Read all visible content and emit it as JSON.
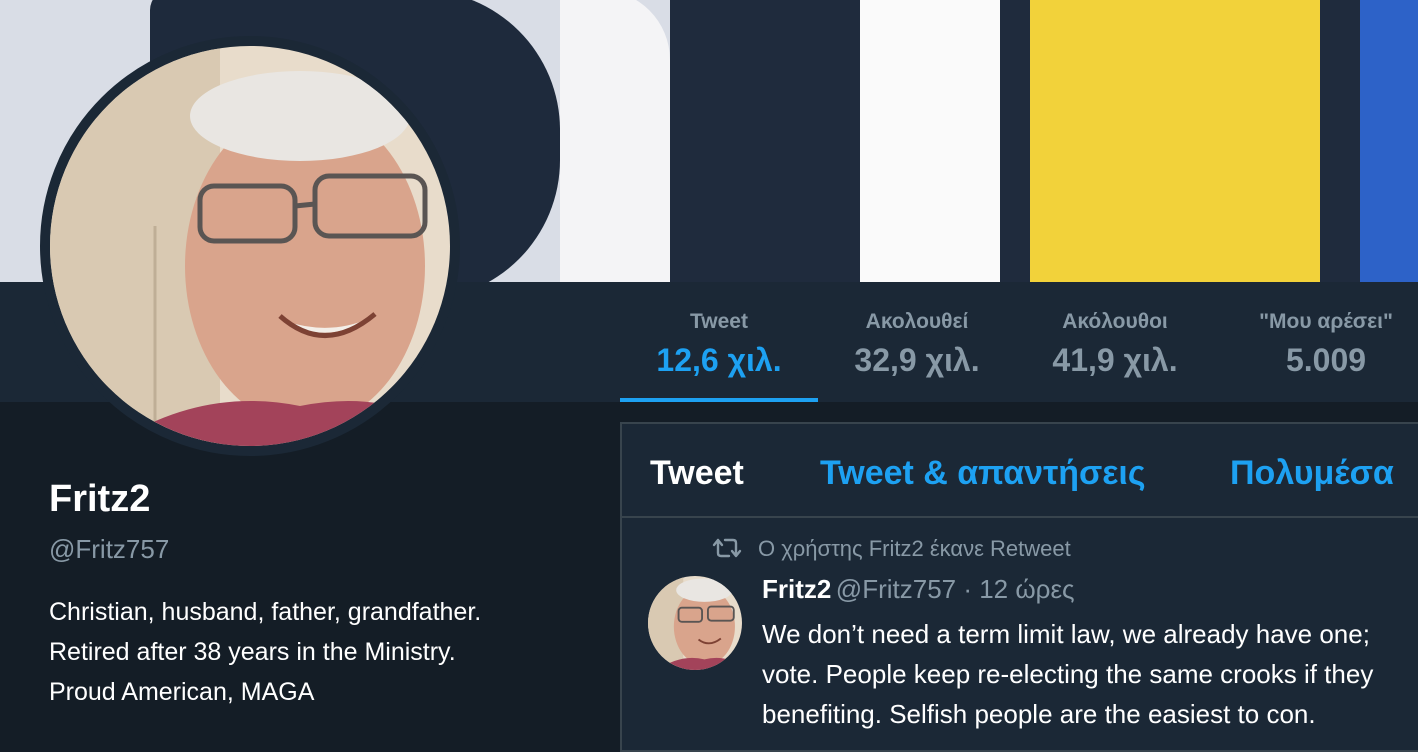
{
  "stats": [
    {
      "label": "Tweet",
      "value": "12,6 χιλ."
    },
    {
      "label": "Ακολουθεί",
      "value": "32,9 χιλ."
    },
    {
      "label": "Ακόλουθοι",
      "value": "41,9 χιλ."
    },
    {
      "label": "\"Μου αρέσει\"",
      "value": "5.009"
    }
  ],
  "profile": {
    "name": "Fritz2",
    "handle": "@Fritz757",
    "bio": [
      "Christian, husband, father, grandfather.",
      "Retired after 38 years in the Ministry.",
      "Proud American, MAGA"
    ]
  },
  "timeline": {
    "tabs": [
      "Tweet",
      "Tweet & απαντήσεις",
      "Πολυμέσα"
    ],
    "retweet_notice": "Ο χρήστης Fritz2 έκανε Retweet",
    "tweet": {
      "name": "Fritz2",
      "meta": "@Fritz757 · 12 ώρες",
      "text": [
        "We don’t need a term limit law, we already have one;",
        "vote. People keep re-electing the same crooks if they",
        "benefiting. Selfish people are the easiest to con."
      ]
    }
  },
  "colors": {
    "accent": "#1da1f2",
    "background": "#141d26",
    "panel": "#1b2836",
    "muted": "#8899a6"
  },
  "icons": [
    "retweet-icon"
  ]
}
